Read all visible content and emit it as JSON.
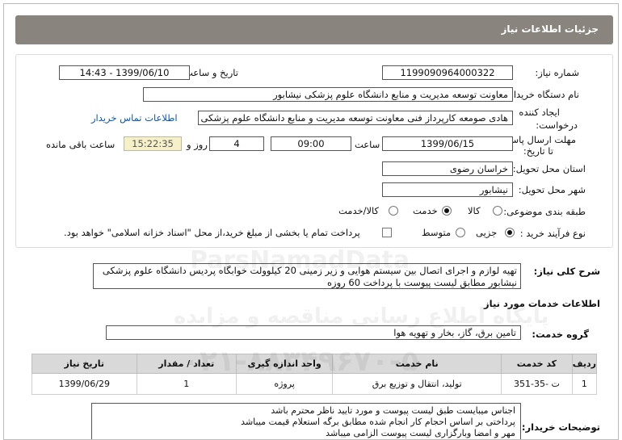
{
  "header": {
    "title": "جزئیات اطلاعات نیاز"
  },
  "form": {
    "need_number_label": "شماره نیاز:",
    "need_number": "1199090964000322",
    "announce_label": "تاریخ و ساعت اعلان عمومی:",
    "announce_value": "1399/06/10 - 14:43",
    "buyer_label": "نام دستگاه خریدار:",
    "buyer_value": "معاونت توسعه مدیریت و منابع دانشگاه علوم پزشکی نیشابور",
    "creator_label_1": "ایجاد کننده",
    "creator_label_2": "درخواست:",
    "creator_value": "هادی صومعه کارپرداز فنی معاونت توسعه مدیریت و منابع دانشگاه علوم پزشکی",
    "contact_link": "اطلاعات تماس خریدار",
    "deadline_label_1": "مهلت ارسال پاسخ:",
    "deadline_label_2": "تا تاریخ:",
    "deadline_date": "1399/06/15",
    "time_label": "ساعت",
    "deadline_time": "09:00",
    "days_value": "4",
    "days_label": "روز و",
    "remaining_time": "15:22:35",
    "remaining_label": "ساعت باقی مانده",
    "province_label": "استان محل تحویل:",
    "province_value": "خراسان رضوی",
    "city_label": "شهر محل تحویل:",
    "city_value": "نیشابور",
    "category_label": "طبقه بندی موضوعی:",
    "category_options": [
      "کالا",
      "خدمت",
      "کالا/خدمت"
    ],
    "category_selected": "خدمت",
    "process_label": "نوع فرآیند خرید :",
    "process_options": [
      "جزیی",
      "متوسط"
    ],
    "process_selected": "جزیی",
    "payment_text": "پرداخت تمام یا بخشی از مبلغ خرید،از محل \"اسناد خزانه اسلامی\" خواهد بود."
  },
  "description": {
    "label": "شرح کلی نیاز:",
    "text": "تهیه  لوازم و اجرای اتصال بین سیستم هوایی و زیر زمینی 20 کیلوولت خوابگاه پردیس دانشگاه علوم پزشکی نیشابور مطابق لیست  پیوست با پرداخت 60 روزه"
  },
  "services": {
    "section_title": "اطلاعات خدمات مورد نیاز",
    "group_label": "گروه خدمت:",
    "group_value": "تامین برق، گاز، بخار و تهویه هوا",
    "columns": [
      "ردیف",
      "کد خدمت",
      "نام خدمت",
      "واحد اندازه گیری",
      "تعداد / مقدار",
      "تاریخ نیاز"
    ],
    "rows": [
      {
        "index": "1",
        "code": "ت -35-351",
        "name": "تولید، انتقال و توزیع برق",
        "unit": "پروژه",
        "qty": "1",
        "date": "1399/06/29"
      }
    ]
  },
  "notes": {
    "label": "توضیحات خریدار:",
    "lines": [
      "اجناس میبایست طبق لیست پیوست و مورد تایید ناظر محترم باشد",
      "پرداختی بر اساس احجام کار انجام شده مطابق برگه استعلام قیمت میباشد",
      "مهر و امضا وبارگزاری لیست پیوست الزامی میباشد"
    ]
  },
  "watermark": {
    "line1": "ParsNamadData",
    "line2": "پایگاه اطلاع رسانی مناقصه و مزایده",
    "line3": "۰۲۱-۸۸۳۴۹۶۷۰-۵"
  }
}
